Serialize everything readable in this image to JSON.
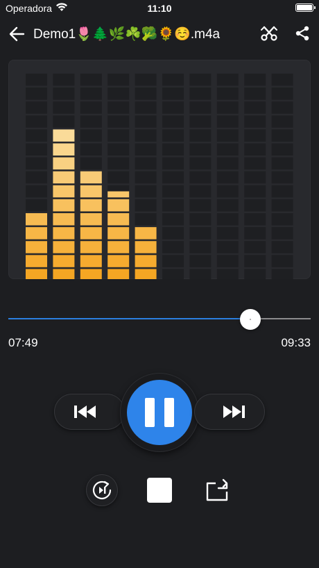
{
  "status_bar": {
    "carrier": "Operadora",
    "time": "11:10"
  },
  "nav": {
    "title": "Demo1🌷🌲🌿☘️🥦🌻☺️.m4a",
    "icons": {
      "back": "arrow-left-icon",
      "cut": "scissors-icon",
      "share": "share-icon"
    }
  },
  "equalizer": {
    "columns": 10,
    "rows": 15,
    "levels": [
      5,
      11,
      8,
      6.5,
      4,
      0.1,
      0.15,
      0.1,
      0,
      0.1
    ]
  },
  "player": {
    "progress": 0.8,
    "elapsed": "07:49",
    "total": "09:33",
    "state": "playing"
  },
  "controls": {
    "previous": "skip-previous-icon",
    "pause": "pause-icon",
    "next": "skip-next-icon",
    "replay": "replay-icon",
    "stop": "stop-icon",
    "repeat": "repeat-icon"
  },
  "colors": {
    "accent": "#2e84ea",
    "background": "#1d1e21",
    "bar_top": "#f5a623",
    "bar_bottom": "#fbe2a8"
  }
}
